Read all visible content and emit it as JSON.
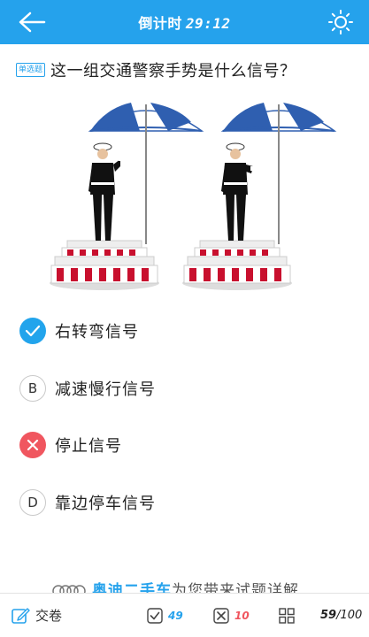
{
  "header": {
    "countdown_label": "倒计时",
    "countdown_time": "29:12",
    "bg_color": "#25a2ec"
  },
  "question": {
    "type_badge": "单选题",
    "text": "这一组交通警察手势是什么信号？"
  },
  "options": [
    {
      "letter": "✓",
      "text": "右转弯信号",
      "state": "correct"
    },
    {
      "letter": "B",
      "text": "减速慢行信号",
      "state": "unselected"
    },
    {
      "letter": "✕",
      "text": "停止信号",
      "state": "wrong"
    },
    {
      "letter": "D",
      "text": "靠边停车信号",
      "state": "unselected"
    }
  ],
  "ad": {
    "brand": "奥迪二手车",
    "text": "为您带来试题详解"
  },
  "footer": {
    "submit_label": "交卷",
    "correct_count": "49",
    "wrong_count": "10",
    "progress_current": "59",
    "progress_total": "/100"
  },
  "icons": {
    "back": "back-arrow-icon",
    "brightness": "sun-icon",
    "submit": "edit-icon",
    "correct": "check-box-icon",
    "wrong": "x-box-icon",
    "grid": "grid-icon"
  },
  "colors": {
    "accent": "#25a2ec",
    "correct": "#22a4ec",
    "wrong": "#f0565f"
  }
}
